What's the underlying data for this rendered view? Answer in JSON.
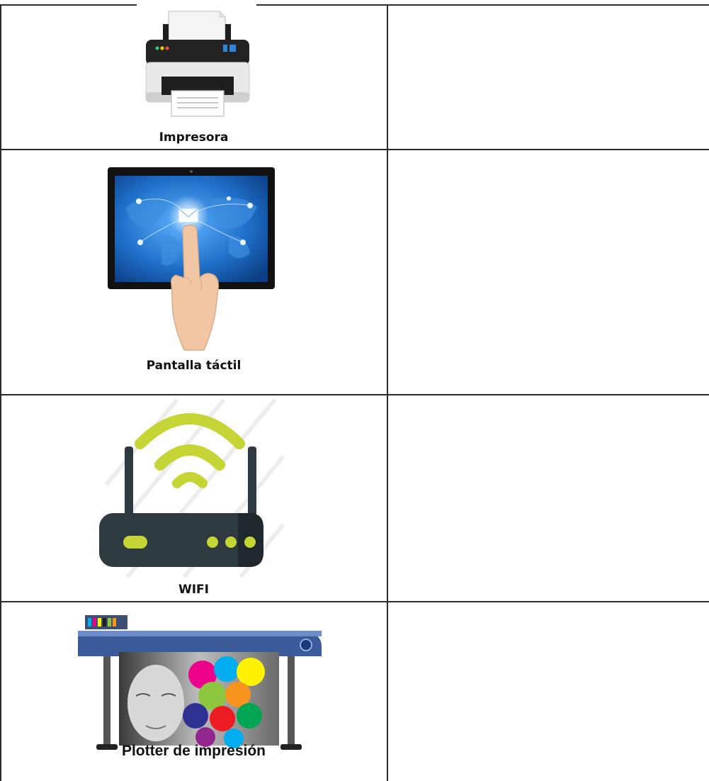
{
  "table": {
    "rows": [
      {
        "label": "Impresora",
        "icon": "printer-icon",
        "answer": ""
      },
      {
        "label": "Pantalla táctil",
        "icon": "touchscreen-icon",
        "answer": ""
      },
      {
        "label": "WIFI",
        "icon": "wifi-router-icon",
        "answer": ""
      },
      {
        "label": "Plotter de impresión",
        "icon": "plotter-icon",
        "answer": ""
      }
    ]
  },
  "colors": {
    "border": "#2b2b2b",
    "wifi_green": "#c5d535",
    "router_body": "#2e3a40",
    "screen_blue": "#1f6fc9"
  }
}
